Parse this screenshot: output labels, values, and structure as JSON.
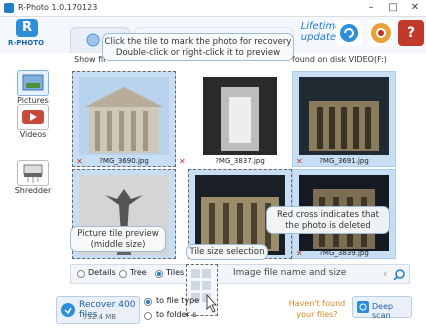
{
  "window": {
    "title": "R-Photo 1.0.170123",
    "min": "–",
    "max": "□",
    "close": "✕"
  },
  "header": {
    "logo": "R-PHOTO",
    "logo_mark": "R",
    "lifetime": "Lifetime updates",
    "help_label": "?"
  },
  "strip": {
    "left": "Show fil",
    "right": "found on disk VIDEO(F:)"
  },
  "nav": [
    {
      "label": "Pictures"
    },
    {
      "label": "Videos"
    },
    {
      "label": "Shredder"
    }
  ],
  "tiles": [
    {
      "name": "?MG_3690.jpg",
      "cross": true
    },
    {
      "name": "?MG_3837.jpg",
      "cross": false
    },
    {
      "name": "?MG_3691.jpg",
      "cross": true
    },
    {
      "name": "",
      "cross": false
    },
    {
      "name": "",
      "cross": false
    },
    {
      "name": "?MG_3839.jpg",
      "cross": true
    }
  ],
  "callouts": {
    "top": "Click the tile to mark the photo for recovery\nDouble-click or right-click it to preview",
    "preview": "Picture tile preview\n(middle size)",
    "tilesize": "Tile size selection",
    "redcross": "Red cross indicates that\nthe photo is deleted",
    "filename": "Image file name and size"
  },
  "view": {
    "details": "Details",
    "tree": "Tree",
    "tiles": "Tiles"
  },
  "footer": {
    "recover": "Recover 400 files",
    "recover_size": "732.4 MB",
    "opt1": "to file type",
    "opt2": "to folder s",
    "havent": "Haven't found your files?",
    "deepscan": "Deep scan"
  },
  "colors": {
    "accent": "#1e7cc8",
    "tile_selected": "#c7def4",
    "cross": "#c0392b"
  }
}
